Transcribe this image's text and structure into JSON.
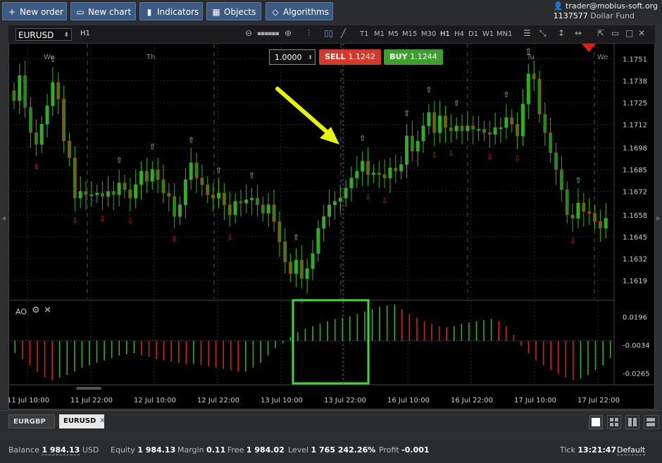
{
  "toolbar": {
    "new_order": "New order",
    "new_chart": "New chart",
    "indicators": "Indicators",
    "objects": "Objects",
    "algorithms": "Algorithms"
  },
  "account": {
    "email": "trader@mobius-soft.org",
    "number": "1137577",
    "fund": "Dollar Fund"
  },
  "chart_window": {
    "symbol": "EURUSD",
    "timeframe_current": "H1",
    "timeframes": [
      "T1",
      "M1",
      "M5",
      "M15",
      "M30",
      "H1",
      "H4",
      "D1",
      "W1",
      "MN1"
    ],
    "active_timeframe": "H1",
    "quantity": "1.0000",
    "sell_label": "SELL",
    "sell_price": "1.1242",
    "buy_label": "BUY",
    "buy_price": "1.1244",
    "indicator_label": "AO"
  },
  "chart_data": {
    "type": "candlestick",
    "instrument": "EURUSD",
    "timeframe": "H1",
    "price_axis": [
      "1.1751",
      "1.1738",
      "1.1725",
      "1.1712",
      "1.1698",
      "1.1685",
      "1.1672",
      "1.1658",
      "1.1645",
      "1.1632",
      "1.1619"
    ],
    "ylim": [
      1.1608,
      1.176
    ],
    "day_labels": [
      "We",
      "Th",
      "Tu",
      "We"
    ],
    "time_axis": [
      "11 Jul 10:00",
      "11 Jul 22:00",
      "12 Jul 10:00",
      "12 Jul 22:00",
      "13 Jul 10:00",
      "13 Jul 22:00",
      "16 Jul 10:00",
      "16 Jul 22:00",
      "17 Jul 10:00",
      "17 Jul 22:00"
    ],
    "ao_axis": [
      "0.0196",
      "-0.0034",
      "-0.0265"
    ],
    "ao_ylim": [
      -0.036,
      0.031
    ],
    "closes": [
      1.1726,
      1.1741,
      1.1722,
      1.1707,
      1.17,
      1.1712,
      1.1723,
      1.1737,
      1.1727,
      1.1702,
      1.1692,
      1.1668,
      1.1672,
      1.167,
      1.167,
      1.1671,
      1.1669,
      1.1672,
      1.167,
      1.1677,
      1.1673,
      1.1668,
      1.1676,
      1.1684,
      1.1678,
      1.1685,
      1.1679,
      1.1671,
      1.1669,
      1.1657,
      1.1664,
      1.1679,
      1.1689,
      1.168,
      1.1676,
      1.167,
      1.1668,
      1.1671,
      1.1664,
      1.1658,
      1.1666,
      1.1665,
      1.1667,
      1.1668,
      1.1664,
      1.1659,
      1.1664,
      1.1654,
      1.1642,
      1.163,
      1.1623,
      1.1631,
      1.162,
      1.1626,
      1.1635,
      1.165,
      1.1657,
      1.1664,
      1.1666,
      1.1668,
      1.1674,
      1.168,
      1.1684,
      1.169,
      1.1682,
      1.1683,
      1.1682,
      1.168,
      1.1686,
      1.1684,
      1.1688,
      1.1705,
      1.1696,
      1.1702,
      1.1711,
      1.1719,
      1.1707,
      1.1717,
      1.171,
      1.1708,
      1.1711,
      1.1708,
      1.1711,
      1.1709,
      1.1709,
      1.1707,
      1.1706,
      1.171,
      1.171,
      1.1716,
      1.1712,
      1.1705,
      1.1724,
      1.1742,
      1.1739,
      1.1718,
      1.1707,
      1.1695,
      1.1685,
      1.1673,
      1.1658,
      1.1656,
      1.1665,
      1.166,
      1.1659,
      1.1654,
      1.165,
      1.1656
    ],
    "ao": [
      -0.01,
      -0.015,
      -0.02,
      -0.025,
      -0.03,
      -0.032,
      -0.03,
      -0.028,
      -0.025,
      -0.022,
      -0.02,
      -0.018,
      -0.016,
      -0.014,
      -0.012,
      -0.011,
      -0.01,
      -0.012,
      -0.013,
      -0.015,
      -0.016,
      -0.017,
      -0.018,
      -0.019,
      -0.019,
      -0.02,
      -0.021,
      -0.022,
      -0.023,
      -0.024,
      -0.025,
      -0.025,
      -0.022,
      -0.018,
      -0.012,
      -0.006,
      -0.002,
      0.003,
      0.007,
      0.01,
      0.012,
      0.014,
      0.016,
      0.018,
      0.019,
      0.02,
      0.022,
      0.024,
      0.026,
      0.028,
      0.029,
      0.03,
      0.026,
      0.022,
      0.019,
      0.016,
      0.014,
      0.012,
      0.011,
      0.012,
      0.014,
      0.015,
      0.016,
      0.017,
      0.018,
      0.016,
      0.012,
      0.005,
      -0.004,
      -0.01,
      -0.016,
      -0.02,
      -0.024,
      -0.027,
      -0.03,
      -0.032,
      -0.031,
      -0.028,
      -0.024,
      -0.02,
      -0.014
    ]
  },
  "chart_tabs": [
    "EURGBP",
    "EURUSD"
  ],
  "active_tab": "EURUSD",
  "status": {
    "balance_label": "Balance",
    "balance": "1 984.13",
    "currency": "USD",
    "equity_label": "Equity",
    "equity": "1 984.13",
    "margin_label": "Margin",
    "margin": "0.11",
    "free_label": "Free",
    "free": "1 984.02",
    "level_label": "Level",
    "level": "1 765 242.26%",
    "profit_label": "Profit",
    "profit": "-0.001",
    "tick_label": "Tick",
    "tick": "13:21:47",
    "tick_mode": "Default"
  },
  "colors": {
    "up": "#2fae24",
    "down": "#d3231c",
    "annotation_arrow": "#e8f20c",
    "highlight_box": "#45d63a"
  }
}
